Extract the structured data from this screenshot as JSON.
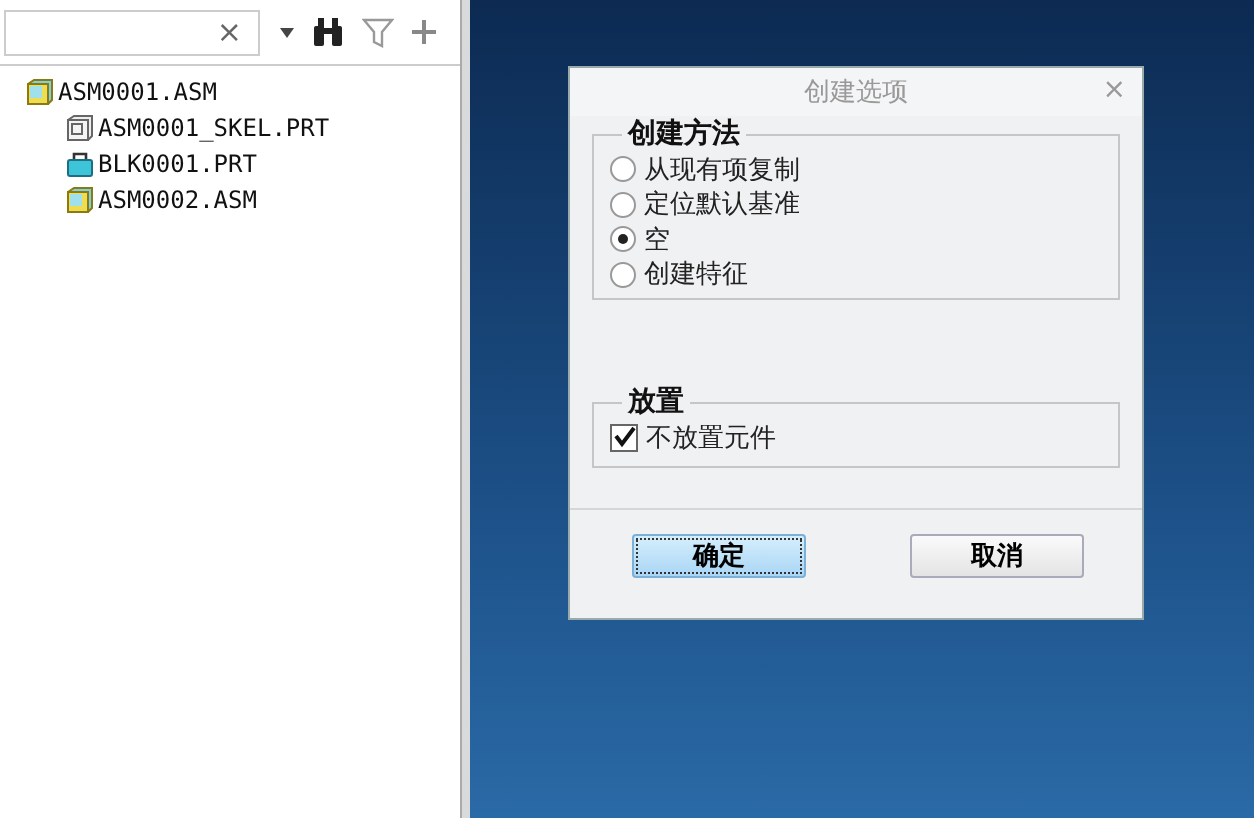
{
  "search": {
    "clear": "×"
  },
  "tree": [
    {
      "label": "ASM0001.ASM",
      "kind": "assembly",
      "children": [
        {
          "label": "ASM0001_SKEL.PRT",
          "kind": "skeleton"
        },
        {
          "label": "BLK0001.PRT",
          "kind": "part"
        },
        {
          "label": "ASM0002.ASM",
          "kind": "assembly"
        }
      ]
    }
  ],
  "dialog": {
    "title": "创建选项",
    "close": "×",
    "method_group": {
      "title": "创建方法",
      "options": [
        {
          "label": "从现有项复制",
          "selected": false
        },
        {
          "label": "定位默认基准",
          "selected": false
        },
        {
          "label": "空",
          "selected": true
        },
        {
          "label": "创建特征",
          "selected": false
        }
      ]
    },
    "placement_group": {
      "title": "放置",
      "checkbox": {
        "label": "不放置元件",
        "checked": true
      }
    },
    "buttons": [
      {
        "label": "确定",
        "default": true
      },
      {
        "label": "取消",
        "default": false
      }
    ]
  }
}
